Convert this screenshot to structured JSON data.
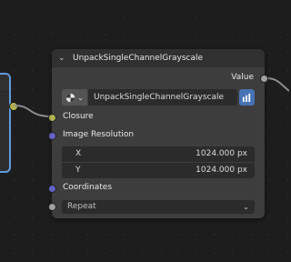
{
  "node": {
    "title": "UnpackSingleChannelGrayscale",
    "output_label": "Value",
    "image_name": "UnpackSingleChannelGrayscale",
    "closure_label": "Closure",
    "resolution_label": "Image Resolution",
    "res_x_label": "X",
    "res_x_value": "1024.000 px",
    "res_y_label": "Y",
    "res_y_value": "1024.000 px",
    "coordinates_label": "Coordinates",
    "extension_value": "Repeat"
  },
  "colors": {
    "closure_socket": "#b1b24f",
    "vector_socket": "#6363c7",
    "value_socket": "#a1a1a1",
    "selected_outline": "#5f9be0",
    "browse_button": "#4772b3"
  },
  "icons": {
    "collapse": "chevron-down-icon",
    "image_type": "image-sphere-icon",
    "browse": "browse-image-icon",
    "dropdown": "chevron-down-icon"
  }
}
